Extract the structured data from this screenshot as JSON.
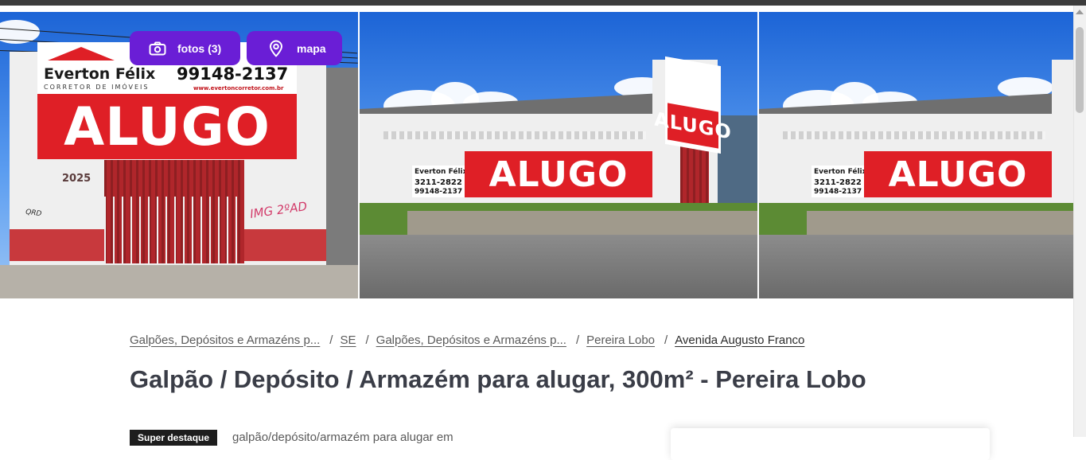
{
  "gallery": {
    "photos_button_label": "fotos (3)",
    "map_button_label": "mapa",
    "photos": [
      {
        "sign_brand": "Everton Félix",
        "sign_subtitle": "CORRETOR DE IMÓVEIS",
        "sign_phone": "99148-2137",
        "sign_website": "www.evertoncorretor.com.br",
        "sign_word": "ALUGO",
        "wall_year": "2025"
      },
      {
        "sign_word": "ALUGO",
        "sign_brand": "Everton Félix",
        "sign_phone_1": "3211-2822",
        "sign_phone_2": "99148-2137"
      },
      {
        "sign_word": "ALUGO",
        "sign_brand": "Everton Félix",
        "sign_phone_1": "3211-2822",
        "sign_phone_2": "99148-2137"
      }
    ]
  },
  "breadcrumb": {
    "items": [
      "Galpões, Depósitos e Armazéns p...",
      "SE",
      "Galpões, Depósitos e Armazéns p...",
      "Pereira Lobo",
      "Avenida Augusto Franco"
    ],
    "separator": "/"
  },
  "listing": {
    "title": "Galpão / Depósito / Armazém para alugar, 300m² - Pereira Lobo",
    "badge": "Super destaque",
    "description_preview": "galpão/depósito/armazém para alugar em"
  },
  "colors": {
    "accent": "#6a1ed6",
    "sign_red": "#df1f26",
    "title": "#3a3d47",
    "top_bar": "#3c3c3c"
  },
  "icons": {
    "photos": "camera-icon",
    "map": "map-pin-icon"
  }
}
